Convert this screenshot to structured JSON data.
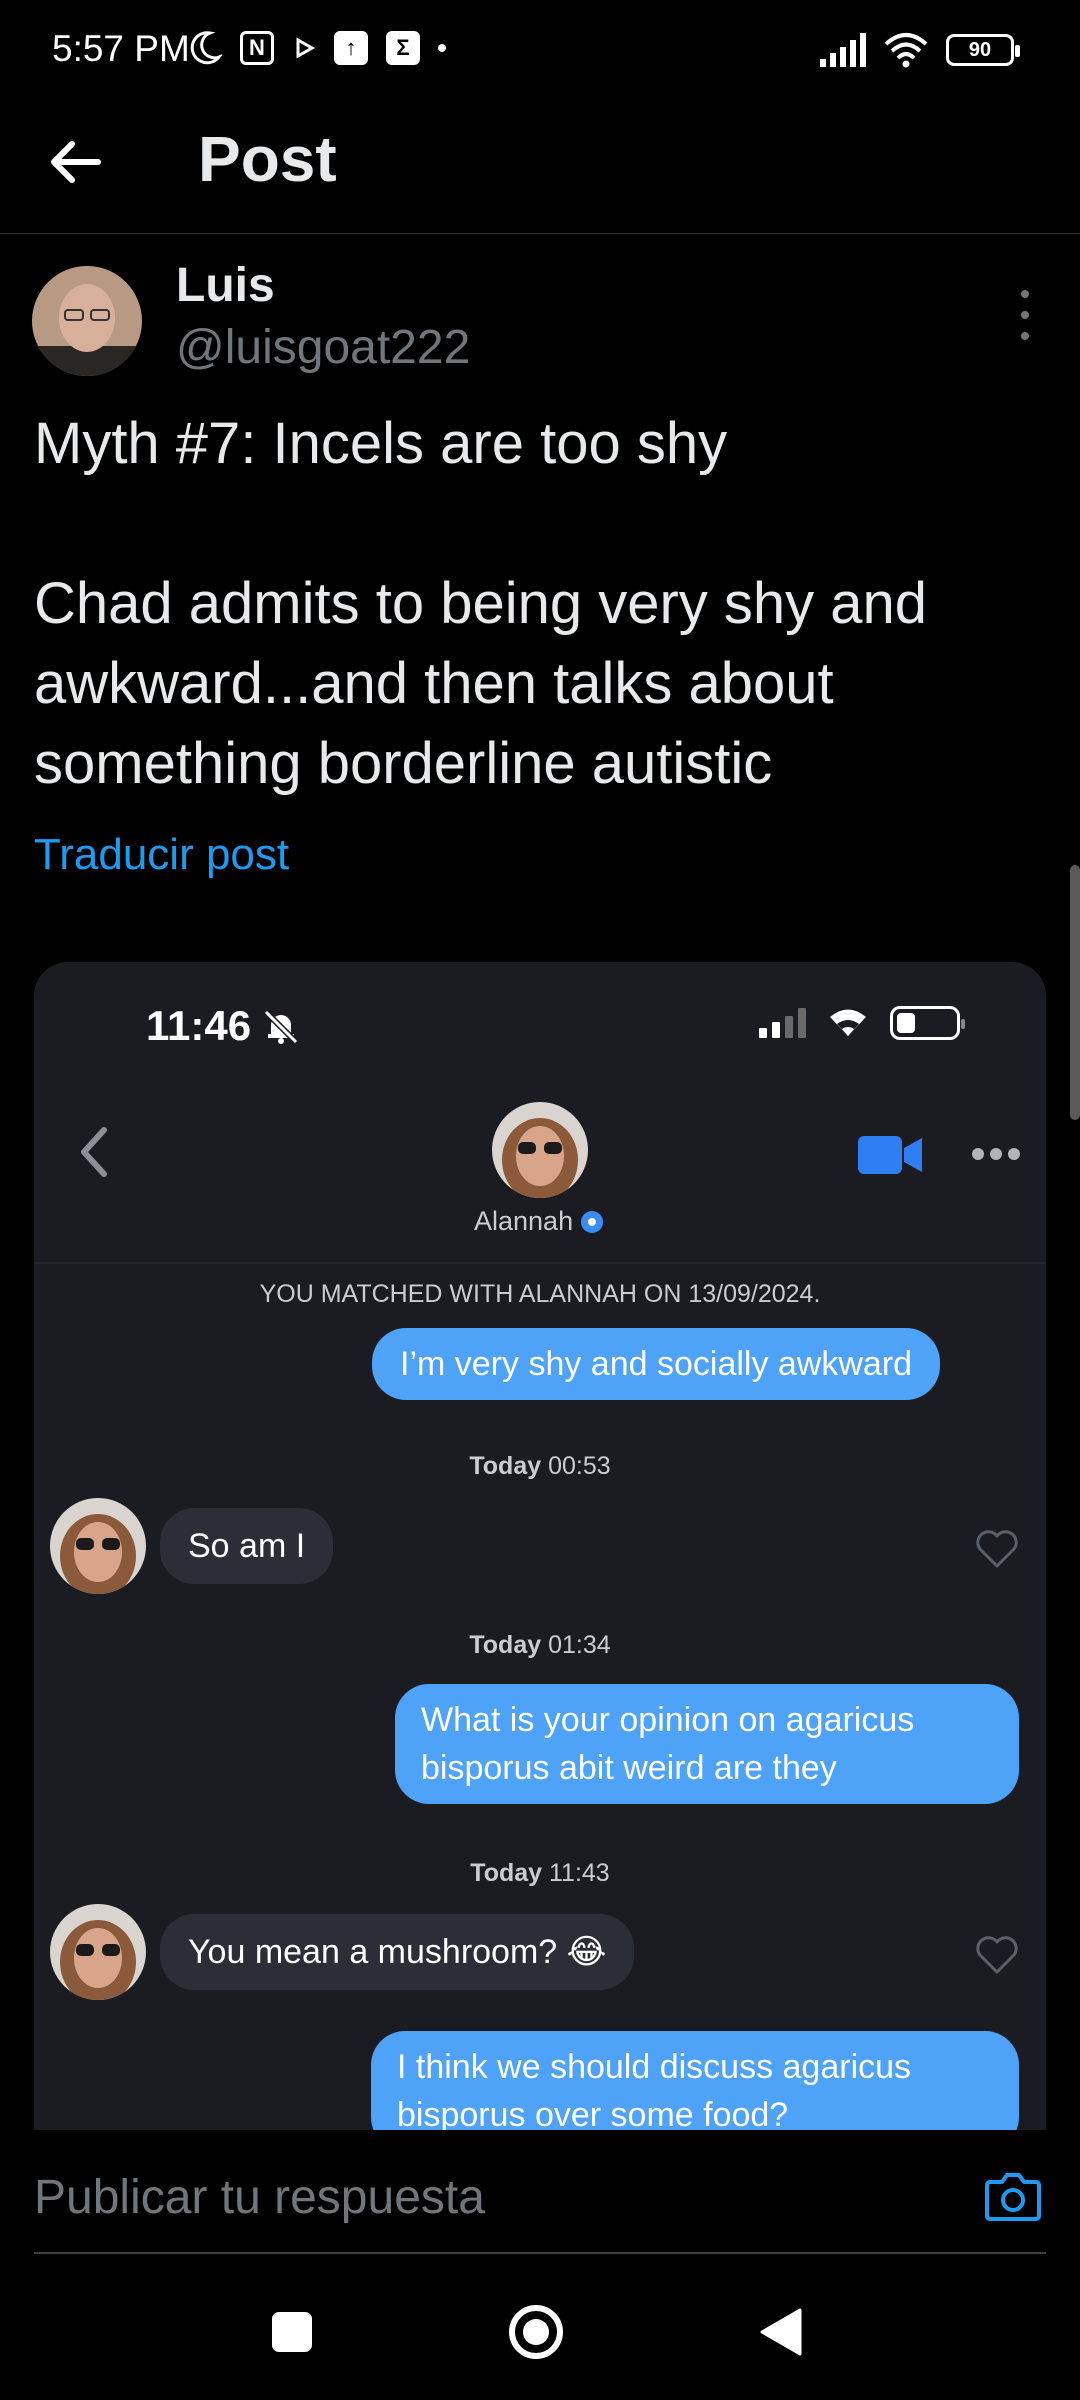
{
  "status_bar": {
    "time": "5:57 PM",
    "icons": [
      "moon-icon",
      "nfc-icon",
      "play-icon",
      "upload-icon",
      "sigma-icon",
      "dot"
    ],
    "battery": "90"
  },
  "header": {
    "title": "Post"
  },
  "author": {
    "name": "Luis",
    "handle": "@luisgoat222"
  },
  "post": {
    "text": "Myth #7: Incels are too shy\n\nChad admits to being very shy and awkward...and then talks about something borderline autistic",
    "translate_label": "Traducir post"
  },
  "embedded": {
    "time": "11:46",
    "contact_name": "Alannah",
    "match_notice": "YOU MATCHED WITH ALANNAH ON 13/09/2024.",
    "messages": [
      {
        "direction": "out",
        "text": "I’m very shy and socially awkward"
      },
      {
        "timestamp_day": "Today",
        "timestamp_time": "00:53"
      },
      {
        "direction": "in",
        "text": "So am I"
      },
      {
        "timestamp_day": "Today",
        "timestamp_time": "01:34"
      },
      {
        "direction": "out",
        "text": "What is your opinion on agaricus bisporus abit weird are they"
      },
      {
        "timestamp_day": "Today",
        "timestamp_time": "11:43"
      },
      {
        "direction": "in",
        "text": "You mean a mushroom? 😂"
      },
      {
        "direction": "out",
        "text": "I think we should discuss agaricus bisporus over some food?"
      }
    ]
  },
  "reply": {
    "placeholder": "Publicar tu respuesta"
  },
  "colors": {
    "background": "#000000",
    "link_blue": "#1d9bf0",
    "bubble_out": "#4ea3f8",
    "bubble_in": "#2b2e36",
    "card_bg": "#1a1c22"
  }
}
